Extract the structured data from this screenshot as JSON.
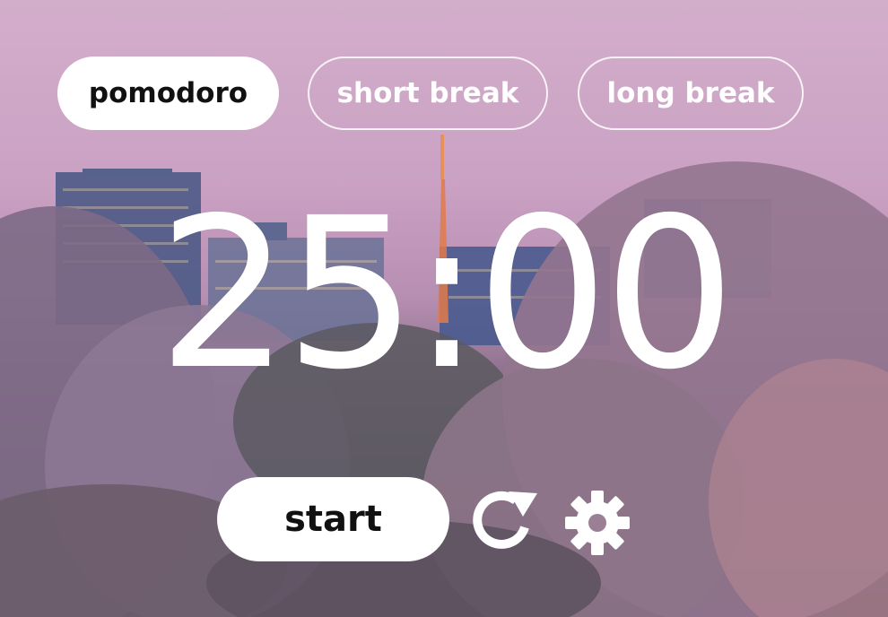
{
  "tabs": [
    {
      "label": "pomodoro",
      "active": true
    },
    {
      "label": "short break",
      "active": false
    },
    {
      "label": "long break",
      "active": false
    }
  ],
  "timer": {
    "display": "25:00"
  },
  "controls": {
    "start_label": "start",
    "reset_icon": "reset-icon",
    "settings_icon": "gear-icon"
  },
  "background": {
    "description_icon": "city-cherry-blossom-background"
  },
  "colors": {
    "sky": "#d3aecb",
    "button_bg": "#ffffff",
    "button_text": "#111111",
    "text_light": "#ffffff"
  }
}
